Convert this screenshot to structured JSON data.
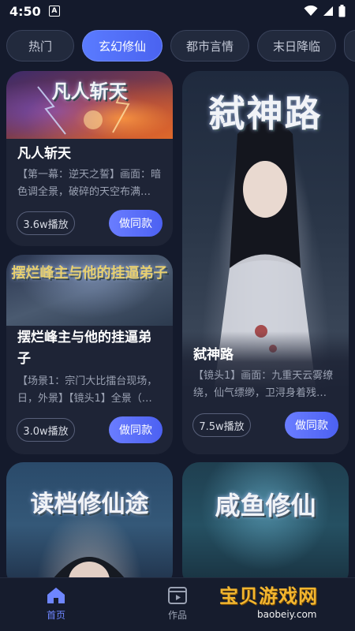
{
  "status": {
    "time": "4:50"
  },
  "tabs": [
    {
      "label": "热门",
      "active": false
    },
    {
      "label": "玄幻修仙",
      "active": true
    },
    {
      "label": "都市言情",
      "active": false
    },
    {
      "label": "末日降临",
      "active": false
    }
  ],
  "cards": [
    {
      "art_title": "凡人斩天",
      "title": "凡人斩天",
      "desc": "【第一幕：逆天之誓】画面：暗色调全景，破碎的天空布满…",
      "plays": "3.6w播放",
      "button": "做同款"
    },
    {
      "art_title": "弑神路",
      "title": "弑神路",
      "desc": "【镜头1】画面：九重天云雾缭绕，仙气缥缈，卫浔身着残…",
      "plays": "7.5w播放",
      "button": "做同款"
    },
    {
      "art_title": "摆烂峰主与他的挂逼弟子",
      "title": "摆烂峰主与他的挂逼弟子",
      "desc": "【场景1：宗门大比擂台现场，日，外景】【镜头1】全景（…",
      "plays": "3.0w播放",
      "button": "做同款"
    },
    {
      "art_title": "读档修仙途",
      "title": "",
      "desc": "",
      "plays": "",
      "button": ""
    },
    {
      "art_title": "咸鱼修仙",
      "title": "",
      "desc": "",
      "plays": "",
      "button": ""
    }
  ],
  "nav": {
    "home": "首页",
    "works": "作品"
  },
  "watermark": {
    "text": "宝贝游戏网",
    "url": "baobeiy.com"
  },
  "colors": {
    "background": "#141a2c",
    "accent": "#5a72ff",
    "watermark": "#f2b630"
  }
}
